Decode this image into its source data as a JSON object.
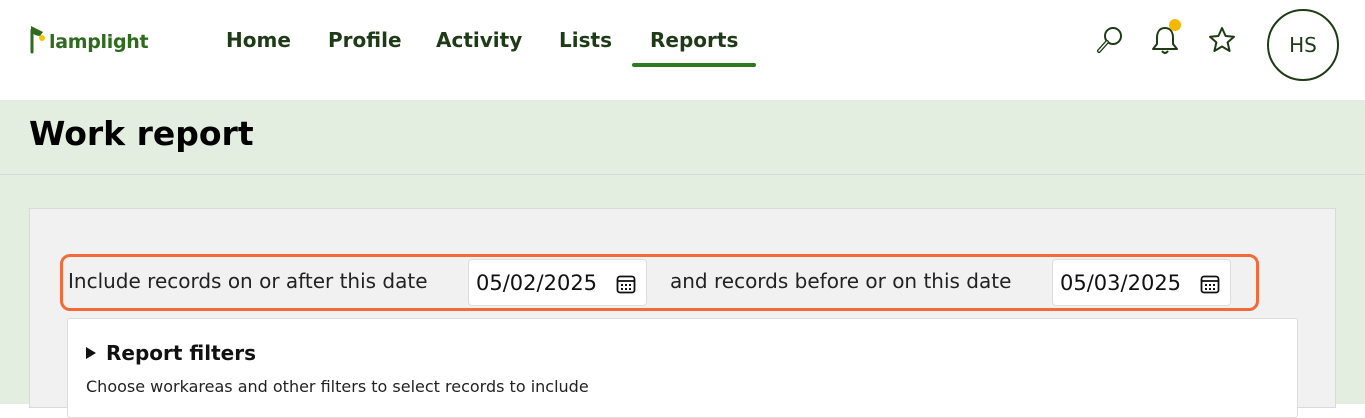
{
  "app": {
    "logo_text": "lamplight"
  },
  "nav": {
    "items": [
      {
        "label": "Home",
        "active": false
      },
      {
        "label": "Profile",
        "active": false
      },
      {
        "label": "Activity",
        "active": false
      },
      {
        "label": "Lists",
        "active": false
      },
      {
        "label": "Reports",
        "active": true
      }
    ]
  },
  "header_icons": [
    "search-icon",
    "bell-icon",
    "star-icon"
  ],
  "notification_dot": true,
  "user": {
    "initials": "HS"
  },
  "page": {
    "title": "Work report"
  },
  "date_range": {
    "after_label": "Include records on or after this date",
    "after_value": "05/02/2025",
    "before_label": "and records before or on this date",
    "before_value": "05/03/2025"
  },
  "filters": {
    "heading": "Report filters",
    "description": "Choose workareas and other filters to select records to include"
  },
  "colors": {
    "brand_green": "#2d7a1f",
    "nav_text": "#1f3a16",
    "band_bg": "#e3eee0",
    "highlight_border": "#f2693a",
    "notification": "#f5b800"
  }
}
